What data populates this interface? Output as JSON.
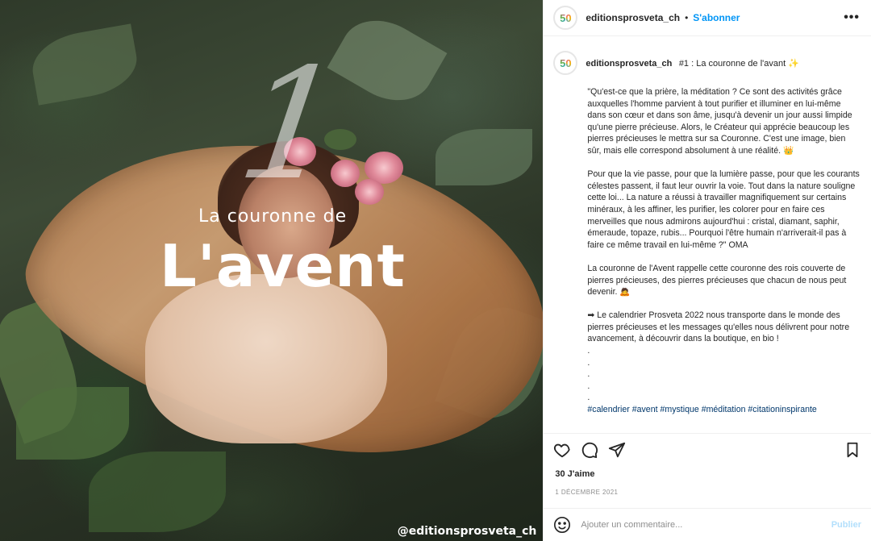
{
  "media": {
    "number": "1",
    "subtitle": "La couronne de",
    "title": "L'avent",
    "watermark": "@editionsprosveta_ch"
  },
  "header": {
    "avatar_text": "50",
    "username": "editionsprosveta_ch",
    "separator": "•",
    "follow_label": "S'abonner",
    "more_icon": "more-icon",
    "more_label": "•••"
  },
  "caption": {
    "username": "editionsprosveta_ch",
    "title": "#1 : La couronne de l'avant ✨",
    "paragraphs": [
      "\"Qu'est-ce que la prière, la méditation ? Ce sont des activités grâce auxquelles l'homme parvient à tout purifier et illuminer en lui-même dans son cœur et dans son âme, jusqu'à devenir un jour aussi limpide qu'une pierre précieuse. Alors, le Créateur qui apprécie beaucoup les pierres précieuses le mettra sur sa Couronne. C'est une image, bien sûr, mais elle correspond absolument à une réalité. 👑",
      "Pour que la vie passe, pour que la lumière passe, pour que les courants célestes passent, il faut leur ouvrir la voie. Tout dans la nature souligne cette loi... La nature a réussi à travailler magnifiquement sur certains minéraux, à les affiner, les purifier, les colorer pour en faire ces merveilles que nous admirons aujourd'hui : cristal, diamant, saphir, émeraude, topaze, rubis... Pourquoi l'être humain n'arriverait-il pas à faire ce même travail en lui-même ?\" OMA",
      "La couronne de l'Avent rappelle cette couronne des rois couverte de pierres précieuses, des pierres précieuses que chacun de nous peut devenir. 🙇",
      "➡ Le calendrier Prosveta 2022 nous transporte dans le monde des pierres précieuses et les messages qu'elles nous délivrent pour notre avancement, à découvrir dans la boutique, en bio !"
    ],
    "dots": [
      ".",
      ".",
      ".",
      ".",
      "."
    ],
    "hashtags": "#calendrier #avent #mystique #méditation #citationinspirante"
  },
  "actions": {
    "like_icon": "heart-icon",
    "comment_icon": "comment-icon",
    "share_icon": "share-icon",
    "save_icon": "bookmark-icon"
  },
  "likes": "30 J'aime",
  "date": "1 DÉCEMBRE 2021",
  "comment": {
    "placeholder": "Ajouter un commentaire...",
    "publish_label": "Publier"
  },
  "colors": {
    "link_blue": "#0095f6",
    "hashtag_blue": "#00376b",
    "publish_disabled": "#b2dffc"
  }
}
